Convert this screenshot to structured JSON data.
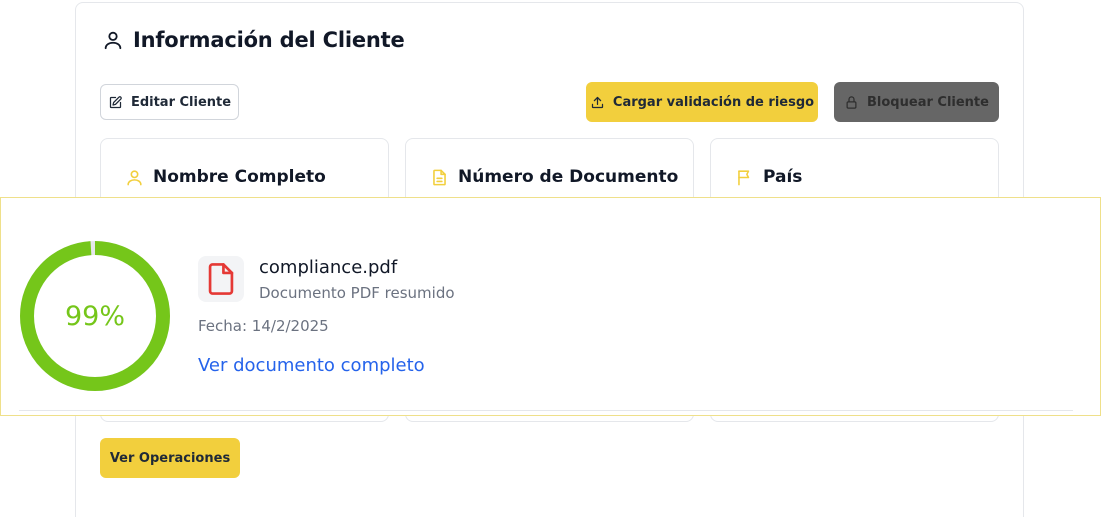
{
  "header": {
    "title": "Información del Cliente",
    "title_icon": "user-icon"
  },
  "toolbar": {
    "edit_label": "Editar Cliente",
    "edit_icon": "edit-icon",
    "upload_label": "Cargar validación de riesgo",
    "upload_icon": "upload-icon",
    "block_label": "Bloquear Cliente",
    "block_icon": "lock-icon"
  },
  "cards": [
    {
      "label": "Nombre Completo",
      "icon": "user-icon"
    },
    {
      "label": "Número de Documento",
      "icon": "file-text-icon"
    },
    {
      "label": "País",
      "icon": "flag-icon"
    }
  ],
  "document": {
    "score": 99,
    "score_text": "99%",
    "file_name": "compliance.pdf",
    "description": "Documento PDF resumido",
    "date": "Fecha: 14/2/2025",
    "link_label": "Ver documento completo",
    "file_icon": "pdf-file-icon"
  },
  "footer": {
    "operations_label": "Ver Operaciones"
  },
  "colors": {
    "accent": "#f2cf3d",
    "score_ring": "#75c61a",
    "pdf_red": "#e53935",
    "link": "#2563eb"
  }
}
